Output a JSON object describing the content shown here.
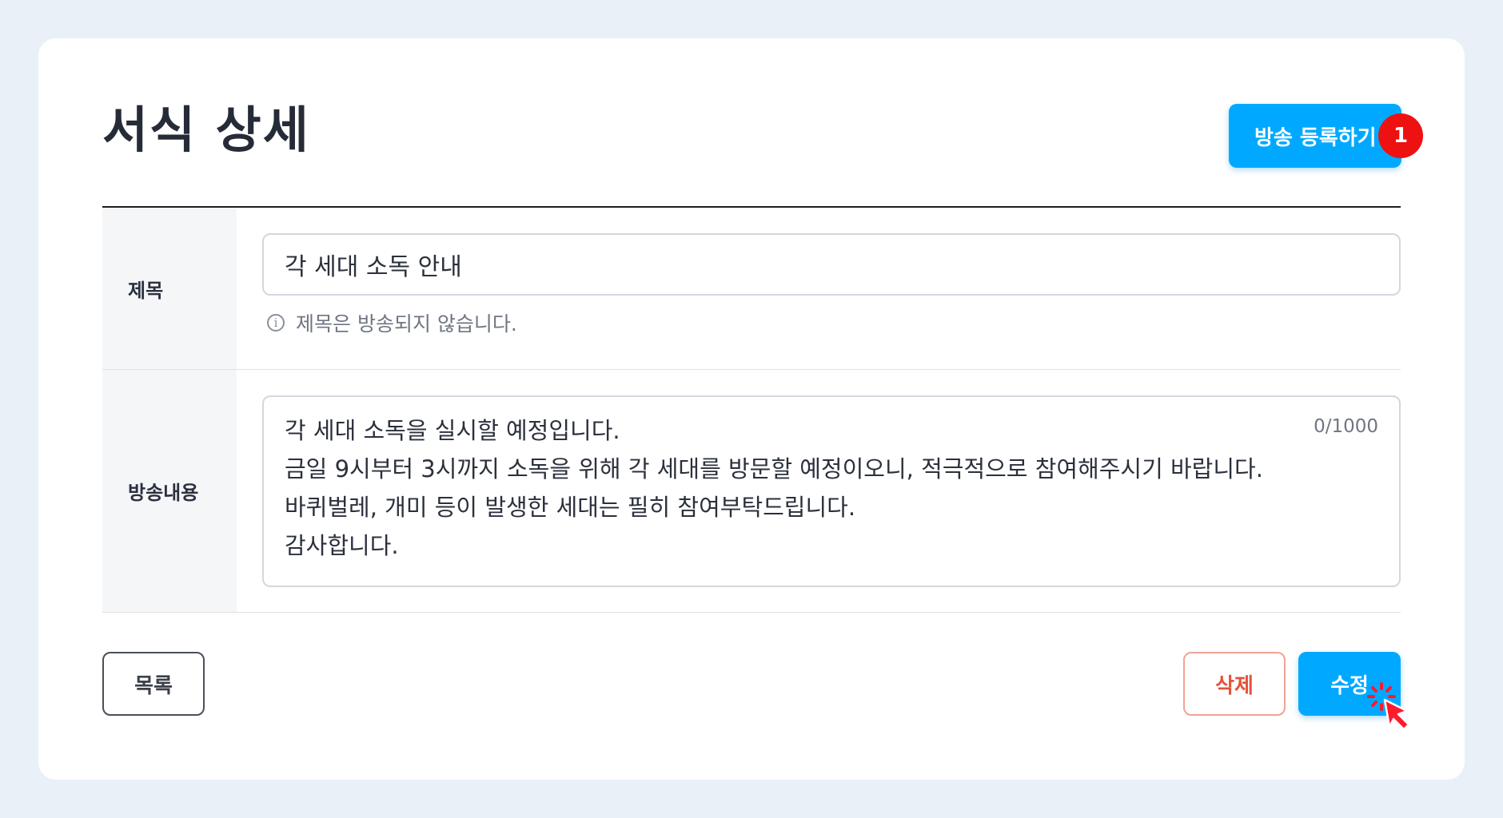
{
  "page": {
    "title": "서식 상세"
  },
  "header": {
    "broadcast_button_label": "방송 등록하기",
    "step_badge": "1"
  },
  "form": {
    "title_label": "제목",
    "title_value": "각 세대 소독 안내",
    "title_hint": "제목은 방송되지 않습니다.",
    "content_label": "방송내용",
    "content_value": "각 세대 소독을 실시할 예정입니다.\n금일 9시부터 3시까지 소독을 위해 각 세대를 방문할 예정이오니, 적극적으로 참여해주시기 바랍니다.\n바퀴벌레, 개미 등이 발생한 세대는 필히 참여부탁드립니다.\n감사합니다.",
    "char_count": "0/1000"
  },
  "actions": {
    "list_label": "목록",
    "delete_label": "삭제",
    "edit_label": "수정"
  },
  "colors": {
    "primary": "#00a9ff",
    "danger": "#e2533b",
    "badge": "#ee1111",
    "background": "#eaf0f8"
  },
  "icons": {
    "hint": "info-icon",
    "pointer": "click-cursor-icon"
  }
}
